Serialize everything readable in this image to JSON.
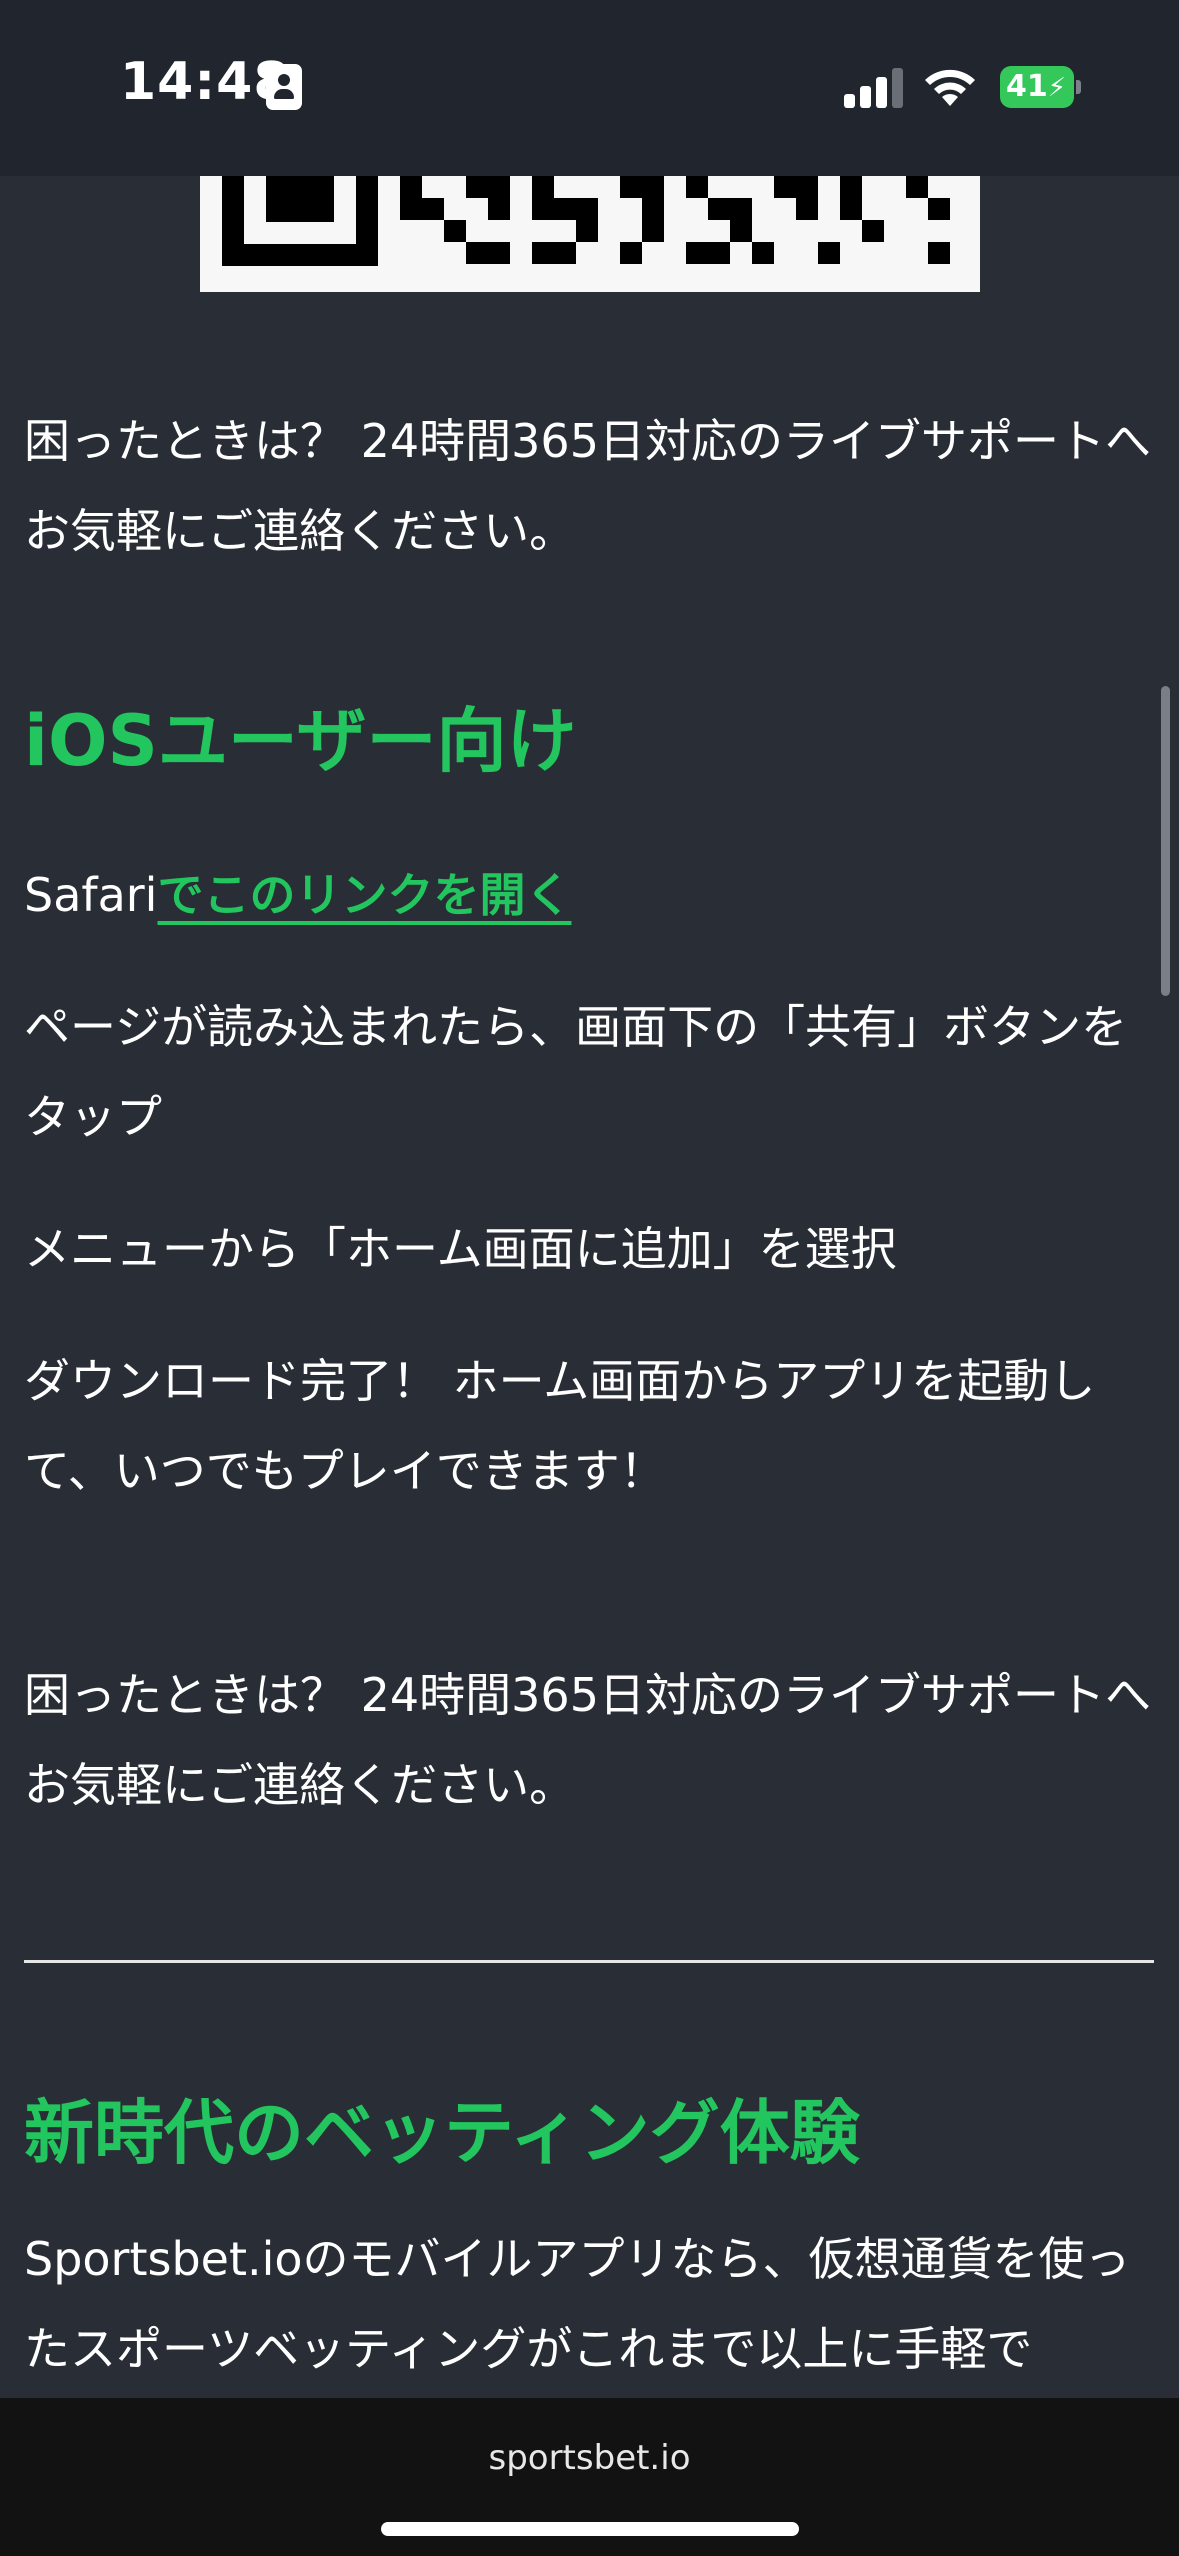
{
  "status_bar": {
    "time": "14:48",
    "battery": "41",
    "icons": [
      "id-card-icon",
      "cellular-signal-icon",
      "wifi-icon",
      "battery-charging-icon"
    ]
  },
  "content": {
    "support_text_1": "困ったときは？ 24時間365日対応のライブサポートへお気軽にご連絡ください。",
    "ios_heading": "iOSユーザー向け",
    "safari_prefix": "Safari",
    "safari_link": "でこのリンクを開く",
    "step_2": "ページが読み込まれたら、画面下の「共有」ボタンをタップ",
    "step_3": "メニューから「ホーム画面に追加」を選択",
    "step_4": "ダウンロード完了！ ホーム画面からアプリを起動して、いつでもプレイできます！",
    "support_text_2": "困ったときは？ 24時間365日対応のライブサポートへお気軽にご連絡ください。",
    "new_era_heading": "新時代のベッティング体験",
    "intro_text": "Sportsbet.ioのモバイルアプリなら、仮想通貨を使ったスポーツベッティングがこれまで以上に手軽で"
  },
  "browser": {
    "url": "sportsbet.io"
  },
  "colors": {
    "background": "#282d36",
    "accent_green": "#22c55e",
    "status_bar": "#20252e",
    "battery_green": "#34c759"
  }
}
